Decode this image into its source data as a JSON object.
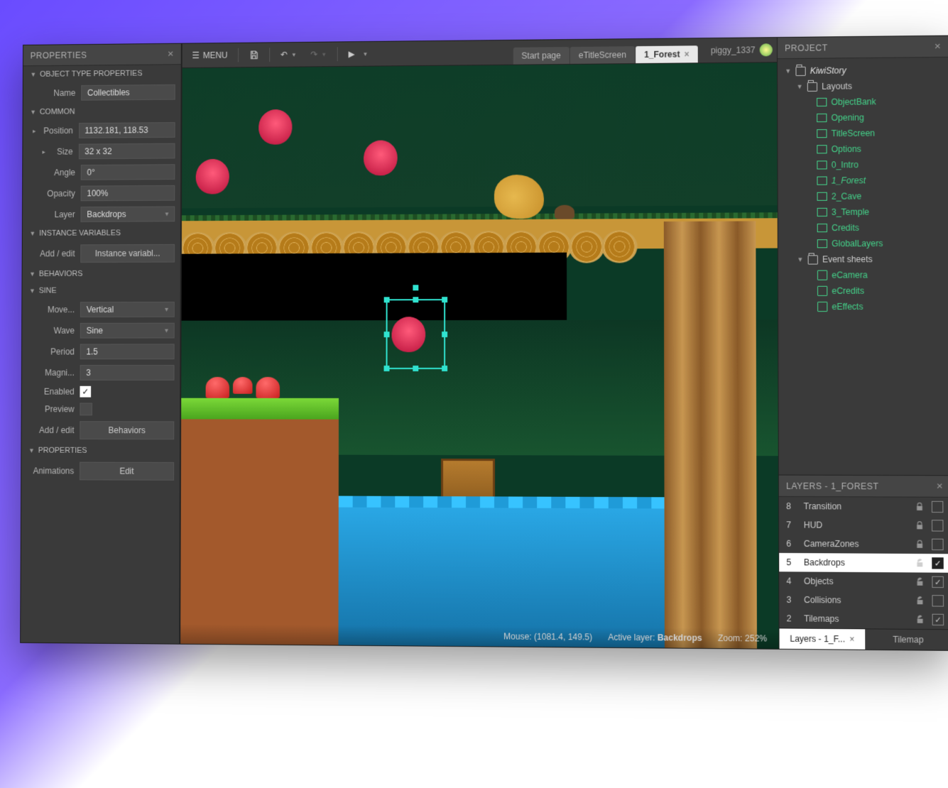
{
  "properties_panel": {
    "title": "PROPERTIES",
    "sections": {
      "object_type": {
        "header": "OBJECT TYPE PROPERTIES",
        "name_label": "Name",
        "name_value": "Collectibles"
      },
      "common": {
        "header": "COMMON",
        "position_label": "Position",
        "position_value": "1132.181, 118.53",
        "size_label": "Size",
        "size_value": "32 x 32",
        "angle_label": "Angle",
        "angle_value": "0°",
        "opacity_label": "Opacity",
        "opacity_value": "100%",
        "layer_label": "Layer",
        "layer_value": "Backdrops"
      },
      "instance_vars": {
        "header": "INSTANCE VARIABLES",
        "add_label": "Add / edit",
        "btn": "Instance variabl..."
      },
      "behaviors_header": "BEHAVIORS",
      "sine": {
        "header": "SINE",
        "move_label": "Move...",
        "move_value": "Vertical",
        "wave_label": "Wave",
        "wave_value": "Sine",
        "period_label": "Period",
        "period_value": "1.5",
        "magni_label": "Magni...",
        "magni_value": "3",
        "enabled_label": "Enabled",
        "enabled_checked": true,
        "preview_label": "Preview",
        "preview_checked": false,
        "add_label": "Add / edit",
        "add_btn": "Behaviors"
      },
      "properties2": {
        "header": "PROPERTIES",
        "anim_label": "Animations",
        "anim_btn": "Edit"
      }
    }
  },
  "toolbar": {
    "menu": "MENU",
    "tabs": [
      {
        "label": "Start page",
        "active": false
      },
      {
        "label": "eTitleScreen",
        "active": false
      },
      {
        "label": "1_Forest",
        "active": true,
        "close": true
      }
    ],
    "user": "piggy_1337"
  },
  "status_bar": {
    "mouse_label": "Mouse:",
    "mouse_value": "(1081.4, 149.5)",
    "layer_label": "Active layer:",
    "layer_value": "Backdrops",
    "zoom_label": "Zoom:",
    "zoom_value": "252%"
  },
  "project_panel": {
    "title": "PROJECT",
    "root": "KiwiStory",
    "layouts_folder": "Layouts",
    "layouts": [
      "ObjectBank",
      "Opening",
      "TitleScreen",
      "Options",
      "0_Intro",
      "1_Forest",
      "2_Cave",
      "3_Temple",
      "Credits",
      "GlobalLayers"
    ],
    "events_folder": "Event sheets",
    "event_sheets": [
      "eCamera",
      "eCredits",
      "eEffects"
    ]
  },
  "layers_panel": {
    "title": "LAYERS - 1_FOREST",
    "rows": [
      {
        "num": "8",
        "name": "Transition",
        "locked": true,
        "visible": false
      },
      {
        "num": "7",
        "name": "HUD",
        "locked": true,
        "visible": false
      },
      {
        "num": "6",
        "name": "CameraZones",
        "locked": true,
        "visible": false
      },
      {
        "num": "5",
        "name": "Backdrops",
        "locked": false,
        "visible": true,
        "active": true
      },
      {
        "num": "4",
        "name": "Objects",
        "locked": false,
        "visible": true
      },
      {
        "num": "3",
        "name": "Collisions",
        "locked": false,
        "visible": false
      },
      {
        "num": "2",
        "name": "Tilemaps",
        "locked": false,
        "visible": true
      }
    ],
    "tabs": [
      {
        "label": "Layers - 1_F...",
        "active": true,
        "close": true
      },
      {
        "label": "Tilemap",
        "active": false
      }
    ]
  }
}
